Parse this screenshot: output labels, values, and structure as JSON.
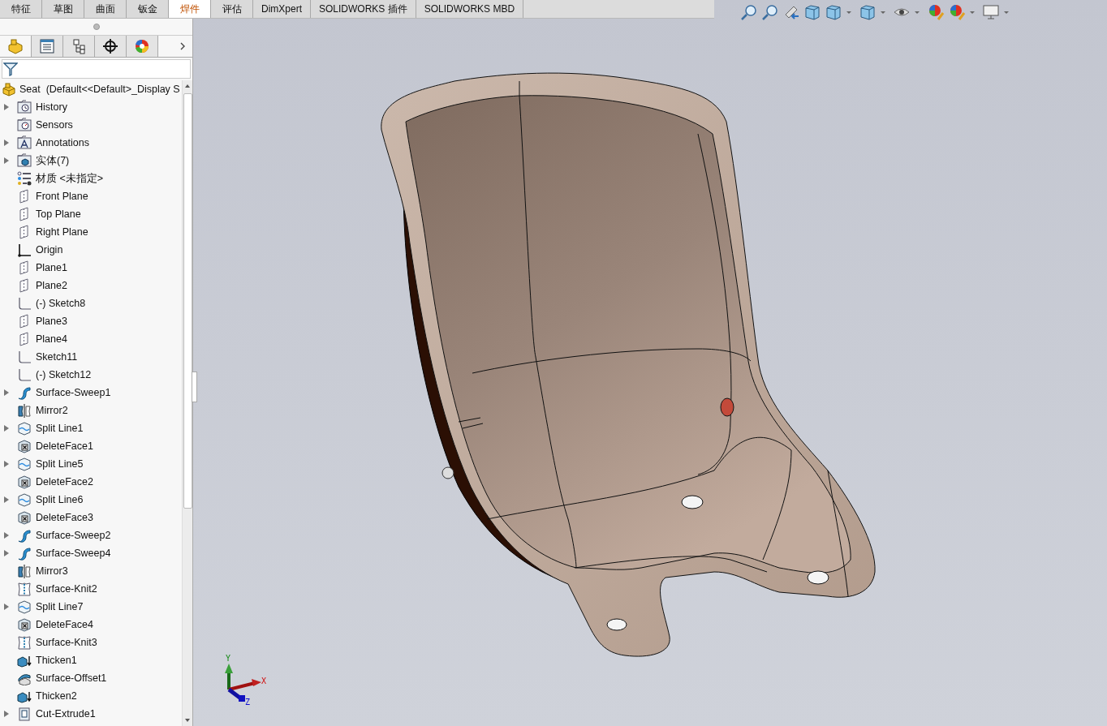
{
  "command_tabs": [
    {
      "label": "特征",
      "selected": false
    },
    {
      "label": "草图",
      "selected": false
    },
    {
      "label": "曲面",
      "selected": false
    },
    {
      "label": "钣金",
      "selected": false
    },
    {
      "label": "焊件",
      "selected": true
    },
    {
      "label": "评估",
      "selected": false
    },
    {
      "label": "DimXpert",
      "selected": false
    },
    {
      "label": "SOLIDWORKS 插件",
      "selected": false
    },
    {
      "label": "SOLIDWORKS MBD",
      "selected": false
    }
  ],
  "panel_tabs": [
    {
      "kind": "feature-tree",
      "selected": true
    },
    {
      "kind": "property",
      "selected": false
    },
    {
      "kind": "configuration",
      "selected": false
    },
    {
      "kind": "dimxpert",
      "selected": false
    },
    {
      "kind": "appearance",
      "selected": false
    }
  ],
  "feature_tree": {
    "root": {
      "label": "Seat  (Default<<Default>_Display S",
      "kind": "part"
    },
    "items": [
      {
        "label": "History",
        "kind": "history",
        "expandable": true
      },
      {
        "label": "Sensors",
        "kind": "sensors",
        "expandable": false
      },
      {
        "label": "Annotations",
        "kind": "annotations",
        "expandable": true
      },
      {
        "label": "实体(7)",
        "kind": "solids",
        "expandable": true
      },
      {
        "label": "材质 <未指定>",
        "kind": "material",
        "expandable": false
      },
      {
        "label": "Front Plane",
        "kind": "plane",
        "expandable": false
      },
      {
        "label": "Top Plane",
        "kind": "plane",
        "expandable": false
      },
      {
        "label": "Right Plane",
        "kind": "plane",
        "expandable": false
      },
      {
        "label": "Origin",
        "kind": "origin",
        "expandable": false
      },
      {
        "label": "Plane1",
        "kind": "plane",
        "expandable": false
      },
      {
        "label": "Plane2",
        "kind": "plane",
        "expandable": false
      },
      {
        "label": "(-) Sketch8",
        "kind": "sketch",
        "expandable": false
      },
      {
        "label": "Plane3",
        "kind": "plane",
        "expandable": false
      },
      {
        "label": "Plane4",
        "kind": "plane",
        "expandable": false
      },
      {
        "label": "Sketch11",
        "kind": "sketch",
        "expandable": false
      },
      {
        "label": "(-) Sketch12",
        "kind": "sketch",
        "expandable": false
      },
      {
        "label": "Surface-Sweep1",
        "kind": "sweep",
        "expandable": true
      },
      {
        "label": "Mirror2",
        "kind": "mirror",
        "expandable": false
      },
      {
        "label": "Split Line1",
        "kind": "split",
        "expandable": true
      },
      {
        "label": "DeleteFace1",
        "kind": "delete",
        "expandable": false
      },
      {
        "label": "Split Line5",
        "kind": "split",
        "expandable": true
      },
      {
        "label": "DeleteFace2",
        "kind": "delete",
        "expandable": false
      },
      {
        "label": "Split Line6",
        "kind": "split",
        "expandable": true
      },
      {
        "label": "DeleteFace3",
        "kind": "delete",
        "expandable": false
      },
      {
        "label": "Surface-Sweep2",
        "kind": "sweep",
        "expandable": true
      },
      {
        "label": "Surface-Sweep4",
        "kind": "sweep",
        "expandable": true
      },
      {
        "label": "Mirror3",
        "kind": "mirror",
        "expandable": false
      },
      {
        "label": "Surface-Knit2",
        "kind": "knit",
        "expandable": false
      },
      {
        "label": "Split Line7",
        "kind": "split",
        "expandable": true
      },
      {
        "label": "DeleteFace4",
        "kind": "delete",
        "expandable": false
      },
      {
        "label": "Surface-Knit3",
        "kind": "knit",
        "expandable": false
      },
      {
        "label": "Thicken1",
        "kind": "thicken",
        "expandable": false
      },
      {
        "label": "Surface-Offset1",
        "kind": "offset",
        "expandable": false
      },
      {
        "label": "Thicken2",
        "kind": "thicken",
        "expandable": false
      },
      {
        "label": "Cut-Extrude1",
        "kind": "cut",
        "expandable": true
      }
    ]
  },
  "triad": {
    "x": "X",
    "y": "Y",
    "z": "Z"
  }
}
